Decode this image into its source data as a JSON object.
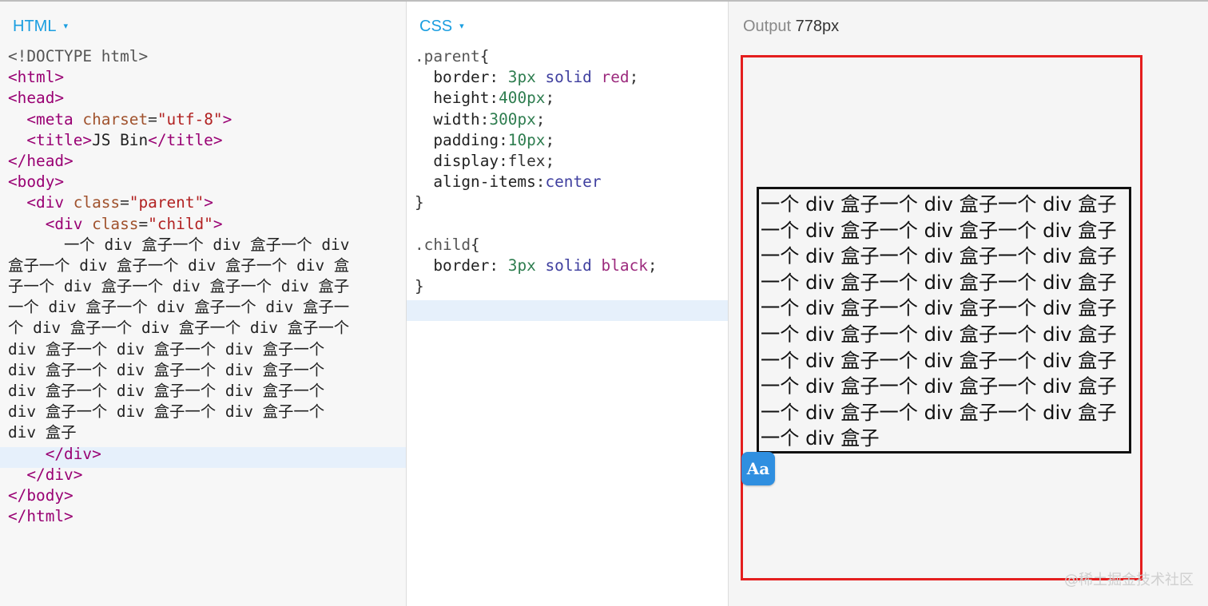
{
  "html_panel": {
    "label": "HTML",
    "caret": "▾",
    "lines": [
      [
        {
          "t": "<!DOCTYPE html>",
          "c": "doc"
        }
      ],
      [
        {
          "t": "<html>",
          "c": "tag"
        }
      ],
      [
        {
          "t": "<head>",
          "c": "tag"
        }
      ],
      [
        {
          "t": "  "
        },
        {
          "t": "<meta ",
          "c": "tag"
        },
        {
          "t": "charset",
          "c": "attr"
        },
        {
          "t": "=",
          "c": "punc"
        },
        {
          "t": "\"utf-8\"",
          "c": "str"
        },
        {
          "t": ">",
          "c": "tag"
        }
      ],
      [
        {
          "t": "  "
        },
        {
          "t": "<title>",
          "c": "tag"
        },
        {
          "t": "JS Bin",
          "c": "text"
        },
        {
          "t": "</title>",
          "c": "tag"
        }
      ],
      [
        {
          "t": "</head>",
          "c": "tag"
        }
      ],
      [
        {
          "t": "<body>",
          "c": "tag"
        }
      ],
      [
        {
          "t": "  "
        },
        {
          "t": "<div ",
          "c": "tag"
        },
        {
          "t": "class",
          "c": "attr"
        },
        {
          "t": "=",
          "c": "punc"
        },
        {
          "t": "\"parent\"",
          "c": "str"
        },
        {
          "t": ">",
          "c": "tag"
        }
      ],
      [
        {
          "t": "    "
        },
        {
          "t": "<div ",
          "c": "tag"
        },
        {
          "t": "class",
          "c": "attr"
        },
        {
          "t": "=",
          "c": "punc"
        },
        {
          "t": "\"child\"",
          "c": "str"
        },
        {
          "t": ">",
          "c": "tag"
        }
      ],
      [
        {
          "t": "      一个 div 盒子一个 div 盒子一个 div",
          "c": "text"
        }
      ],
      [
        {
          "t": "盒子一个 div 盒子一个 div 盒子一个 div 盒",
          "c": "text"
        }
      ],
      [
        {
          "t": "子一个 div 盒子一个 div 盒子一个 div 盒子",
          "c": "text"
        }
      ],
      [
        {
          "t": "一个 div 盒子一个 div 盒子一个 div 盒子一",
          "c": "text"
        }
      ],
      [
        {
          "t": "个 div 盒子一个 div 盒子一个 div 盒子一个",
          "c": "text"
        }
      ],
      [
        {
          "t": "div 盒子一个 div 盒子一个 div 盒子一个",
          "c": "text"
        }
      ],
      [
        {
          "t": "div 盒子一个 div 盒子一个 div 盒子一个",
          "c": "text"
        }
      ],
      [
        {
          "t": "div 盒子一个 div 盒子一个 div 盒子一个",
          "c": "text"
        }
      ],
      [
        {
          "t": "div 盒子一个 div 盒子一个 div 盒子一个",
          "c": "text"
        }
      ],
      [
        {
          "t": "div 盒子",
          "c": "text"
        }
      ],
      [
        {
          "t": "    "
        },
        {
          "t": "</div>",
          "c": "tag"
        }
      ],
      [
        {
          "t": "  "
        },
        {
          "t": "</div>",
          "c": "tag"
        }
      ],
      [
        {
          "t": "</body>",
          "c": "tag"
        }
      ],
      [
        {
          "t": "</html>",
          "c": "tag"
        }
      ]
    ]
  },
  "css_panel": {
    "label": "CSS",
    "caret": "▾",
    "lines": [
      [
        {
          "t": ".parent",
          "c": "sel"
        },
        {
          "t": "{",
          "c": "punc"
        }
      ],
      [
        {
          "t": "  border",
          "c": "prop"
        },
        {
          "t": ": ",
          "c": "punc"
        },
        {
          "t": "3px",
          "c": "num"
        },
        {
          "t": " "
        },
        {
          "t": "solid",
          "c": "kw"
        },
        {
          "t": " "
        },
        {
          "t": "red",
          "c": "col"
        },
        {
          "t": ";",
          "c": "punc"
        }
      ],
      [
        {
          "t": "  height",
          "c": "prop"
        },
        {
          "t": ":",
          "c": "punc"
        },
        {
          "t": "400px",
          "c": "num"
        },
        {
          "t": ";",
          "c": "punc"
        }
      ],
      [
        {
          "t": "  width",
          "c": "prop"
        },
        {
          "t": ":",
          "c": "punc"
        },
        {
          "t": "300px",
          "c": "num"
        },
        {
          "t": ";",
          "c": "punc"
        }
      ],
      [
        {
          "t": "  padding",
          "c": "prop"
        },
        {
          "t": ":",
          "c": "punc"
        },
        {
          "t": "10px",
          "c": "num"
        },
        {
          "t": ";",
          "c": "punc"
        }
      ],
      [
        {
          "t": "  display",
          "c": "prop"
        },
        {
          "t": ":flex;",
          "c": "punc"
        }
      ],
      [
        {
          "t": "  align-items",
          "c": "prop"
        },
        {
          "t": ":",
          "c": "punc"
        },
        {
          "t": "center",
          "c": "kw"
        }
      ],
      [
        {
          "t": "}",
          "c": "punc"
        }
      ],
      [
        {
          "t": ""
        }
      ],
      [
        {
          "t": ".child",
          "c": "sel"
        },
        {
          "t": "{",
          "c": "punc"
        }
      ],
      [
        {
          "t": "  border",
          "c": "prop"
        },
        {
          "t": ": ",
          "c": "punc"
        },
        {
          "t": "3px",
          "c": "num"
        },
        {
          "t": " "
        },
        {
          "t": "solid",
          "c": "kw"
        },
        {
          "t": " "
        },
        {
          "t": "black",
          "c": "col"
        },
        {
          "t": ";",
          "c": "punc"
        }
      ],
      [
        {
          "t": "}",
          "c": "punc"
        }
      ]
    ]
  },
  "output_panel": {
    "label": "Output",
    "width_text": "778px",
    "child_text": "一个 div 盒子一个 div 盒子一个 div 盒子\n一个 div 盒子一个 div 盒子一个 div 盒子\n一个 div 盒子一个 div 盒子一个 div 盒子\n一个 div 盒子一个 div 盒子一个 div 盒子\n一个 div 盒子一个 div 盒子一个 div 盒子\n一个 div 盒子一个 div 盒子一个 div 盒子\n一个 div 盒子一个 div 盒子一个 div 盒子\n一个 div 盒子一个 div 盒子一个 div 盒子\n一个 div 盒子一个 div 盒子一个 div 盒子\n一个 div 盒子",
    "aa_badge": "Aa"
  },
  "watermark": "@稀土掘金技术社区",
  "colors": {
    "label_blue": "#1a9ee0",
    "parent_border": "#e41e1e",
    "child_border": "#111111",
    "active_line": "#e6f0fb",
    "badge_blue": "#2f8fe0"
  }
}
